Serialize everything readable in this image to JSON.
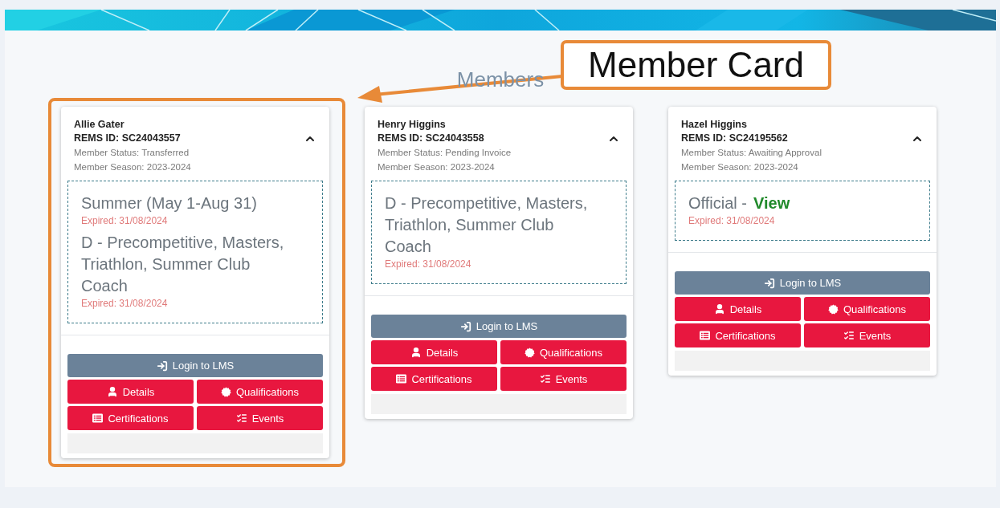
{
  "page_title": "Members",
  "annotation": {
    "label": "Member Card"
  },
  "members": [
    {
      "name": "Allie Gater",
      "rems_id": "REMS ID: SC24043557",
      "status": "Member Status: Transferred",
      "season": "Member Season: 2023-2024",
      "expanded": true,
      "highlighted": true,
      "qualifications": [
        {
          "title": "Summer (May 1-Aug 31)",
          "expiry": "Expired: 31/08/2024"
        },
        {
          "title": "D - Precompetitive, Masters, Triathlon, Summer Club Coach",
          "expiry": "Expired: 31/08/2024"
        }
      ],
      "buttons": [
        {
          "kind": "login",
          "label": "Login to LMS"
        },
        {
          "kind": "details",
          "label": "Details"
        },
        {
          "kind": "qualifications",
          "label": "Qualifications"
        },
        {
          "kind": "certifications",
          "label": "Certifications"
        },
        {
          "kind": "events",
          "label": "Events"
        }
      ]
    },
    {
      "name": "Henry Higgins",
      "rems_id": "REMS ID: SC24043558",
      "status": "Member Status: Pending Invoice",
      "season": "Member Season: 2023-2024",
      "expanded": true,
      "highlighted": false,
      "qualifications": [
        {
          "title": "D - Precompetitive, Masters, Triathlon, Summer Club Coach",
          "expiry": "Expired: 31/08/2024"
        }
      ],
      "buttons": [
        {
          "kind": "login",
          "label": "Login to LMS"
        },
        {
          "kind": "details",
          "label": "Details"
        },
        {
          "kind": "qualifications",
          "label": "Qualifications"
        },
        {
          "kind": "certifications",
          "label": "Certifications"
        },
        {
          "kind": "events",
          "label": "Events"
        }
      ]
    },
    {
      "name": "Hazel Higgins",
      "rems_id": "REMS ID: SC24195562",
      "status": "Member Status: Awaiting Approval",
      "season": "Member Season: 2023-2024",
      "expanded": true,
      "highlighted": false,
      "qualifications": [
        {
          "title": "Official  -",
          "link": "View",
          "expiry": "Expired: 31/08/2024"
        }
      ],
      "buttons": [
        {
          "kind": "login",
          "label": "Login to LMS"
        },
        {
          "kind": "details",
          "label": "Details"
        },
        {
          "kind": "qualifications",
          "label": "Qualifications"
        },
        {
          "kind": "certifications",
          "label": "Certifications"
        },
        {
          "kind": "events",
          "label": "Events"
        }
      ]
    }
  ]
}
